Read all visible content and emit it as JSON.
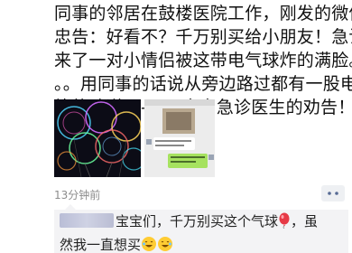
{
  "post": {
    "lines": [
      "同事的邻居在鼓楼医院工作，刚发的微信",
      "忠告：好看不？千万别买给小朋友！急诊",
      "来了一对小情侣被这带电气球炸的满脸。",
      "。。用同事的话说从旁边路过都有一股电",
      "烤的味道！——-来自急诊医生的劝告！"
    ]
  },
  "images": {
    "icons": [
      "balloon-lights-photo",
      "chat-screenshot"
    ]
  },
  "meta": {
    "timestamp": "13分钟前",
    "icons": [
      "comment-icon"
    ]
  },
  "comment": {
    "icons": [
      "balloon-icon",
      "laughing-face-icon"
    ],
    "text_part1": "宝宝们，千万别买这个气球",
    "text_part2": "，虽",
    "text_part3": "然我一直想买"
  },
  "colors": {
    "timestamp": "#8c8c8c",
    "comment_bg": "#f3f3f5",
    "author_name": "#576b95"
  }
}
